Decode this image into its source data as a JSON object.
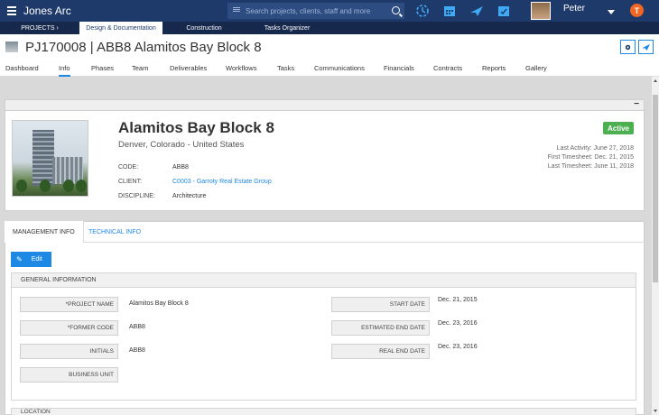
{
  "app": {
    "brand": "Jones Arc",
    "search_placeholder": "Search projects, clients, staff and more",
    "user_name": "Peter"
  },
  "subnav": {
    "projects": "PROJECTS",
    "design": "Design & Documentation",
    "construction": "Construction",
    "tasks": "Tasks Organizer"
  },
  "project": {
    "title": "PJ170008 | ABB8 Alamitos Bay Block 8",
    "name": "Alamitos Bay Block 8",
    "location": "Denver, Colorado - United States",
    "status": "Active",
    "last_activity": "Last Activity: June 27, 2018",
    "first_timesheet": "First Timesheet: Dec. 21, 2015",
    "last_timesheet": "Last Timesheet: June 11, 2018",
    "fields": {
      "code_label": "CODE:",
      "code_value": "ABB8",
      "client_label": "CLIENT:",
      "client_value": "C0003 - Garroty Real Estate Group",
      "discipline_label": "DISCIPLINE:",
      "discipline_value": "Architecture"
    }
  },
  "tabs": [
    "Dashboard",
    "Info",
    "Phases",
    "Team",
    "Deliverables",
    "Workflows",
    "Tasks",
    "Communications",
    "Financials",
    "Contracts",
    "Reports",
    "Gallery"
  ],
  "management": {
    "tab_active": "MANAGEMENT INFO",
    "tab_other": "TECHNICAL INFO",
    "edit_label": "Edit",
    "section_title": "GENERAL INFORMATION",
    "location_section": "LOCATION",
    "left_fields": [
      {
        "label": "*PROJECT NAME",
        "value": "Alamitos Bay Block 8"
      },
      {
        "label": "*FORMER CODE",
        "value": "ABB8"
      },
      {
        "label": "INITIALS",
        "value": "ABB8"
      },
      {
        "label": "BUSINESS UNIT",
        "value": ""
      }
    ],
    "right_fields": [
      {
        "label": "START DATE",
        "value": "Dec. 21, 2015"
      },
      {
        "label": "ESTIMATED END DATE",
        "value": "Dec. 23, 2016"
      },
      {
        "label": "REAL END DATE",
        "value": "Dec. 23, 2016"
      }
    ]
  },
  "colors": {
    "nav": "#1d3a6b",
    "accent": "#1e88e5",
    "status": "#4caf50"
  }
}
